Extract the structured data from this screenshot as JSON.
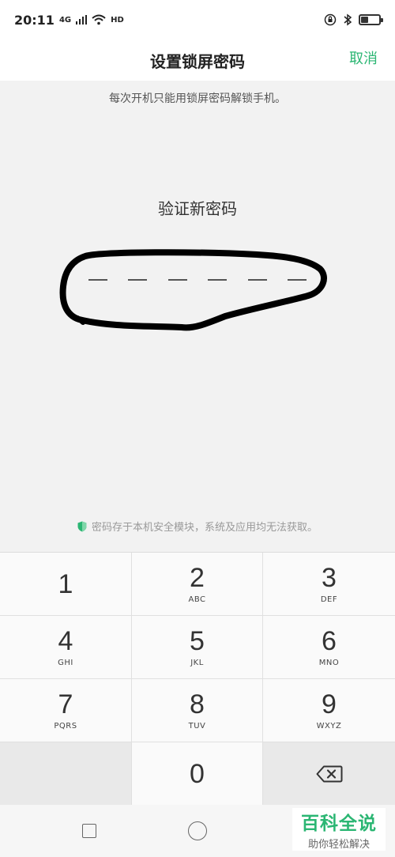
{
  "status_bar": {
    "time": "20:11",
    "signal_label": "4G",
    "hd_label": "HD",
    "icons": [
      "signal-icon",
      "wifi-icon",
      "lock-rotation-icon",
      "bluetooth-icon",
      "battery-icon"
    ]
  },
  "header": {
    "title": "设置锁屏密码",
    "cancel_label": "取消"
  },
  "hint": "每次开机只能用锁屏密码解锁手机。",
  "verify_label": "验证新密码",
  "pin_slots": 6,
  "security_note": "密码存于本机安全模块，系统及应用均无法获取。",
  "keypad": {
    "keys": [
      {
        "digit": "1",
        "letters": ""
      },
      {
        "digit": "2",
        "letters": "ABC"
      },
      {
        "digit": "3",
        "letters": "DEF"
      },
      {
        "digit": "4",
        "letters": "GHI"
      },
      {
        "digit": "5",
        "letters": "JKL"
      },
      {
        "digit": "6",
        "letters": "MNO"
      },
      {
        "digit": "7",
        "letters": "PQRS"
      },
      {
        "digit": "8",
        "letters": "TUV"
      },
      {
        "digit": "9",
        "letters": "WXYZ"
      },
      {
        "digit": "0",
        "letters": ""
      }
    ],
    "backspace_icon": "backspace-icon"
  },
  "watermark": {
    "main": "百科全说",
    "sub": "助你轻松解决"
  },
  "colors": {
    "accent": "#2bb673",
    "background": "#f2f2f2",
    "annotation": "#000000"
  }
}
